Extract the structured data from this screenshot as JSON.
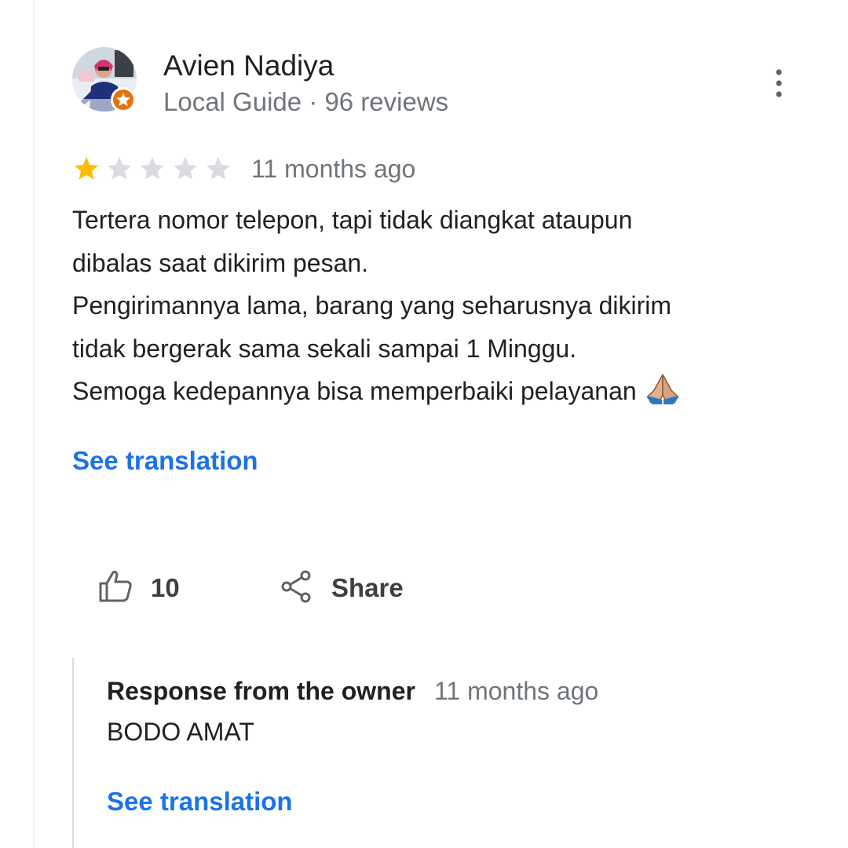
{
  "reviewer": {
    "name": "Avien Nadiya",
    "meta": "Local Guide · 96 reviews"
  },
  "rating": {
    "stars": 1,
    "max": 5,
    "date": "11 months ago",
    "star_color": "#fbbc04",
    "empty_star_color": "#dadce0"
  },
  "review": {
    "lines": [
      "Tertera nomor telepon, tapi tidak diangkat ataupun",
      "dibalas saat dikirim pesan.",
      "Pengirimannya lama, barang yang seharusnya dikirim",
      "tidak bergerak sama sekali sampai 1 Minggu.",
      "Semoga kedepannya bisa memperbaiki pelayanan"
    ],
    "emoji": "folded-hands-icon",
    "see_translation": "See translation"
  },
  "actions": {
    "like_count": "10",
    "share_label": "Share"
  },
  "owner_response": {
    "title": "Response from the owner",
    "date": "11 months ago",
    "text": "BODO AMAT",
    "see_translation": "See translation"
  },
  "colors": {
    "link": "#1a73e8",
    "secondary_text": "#70757a",
    "badge": "#e8710a"
  }
}
